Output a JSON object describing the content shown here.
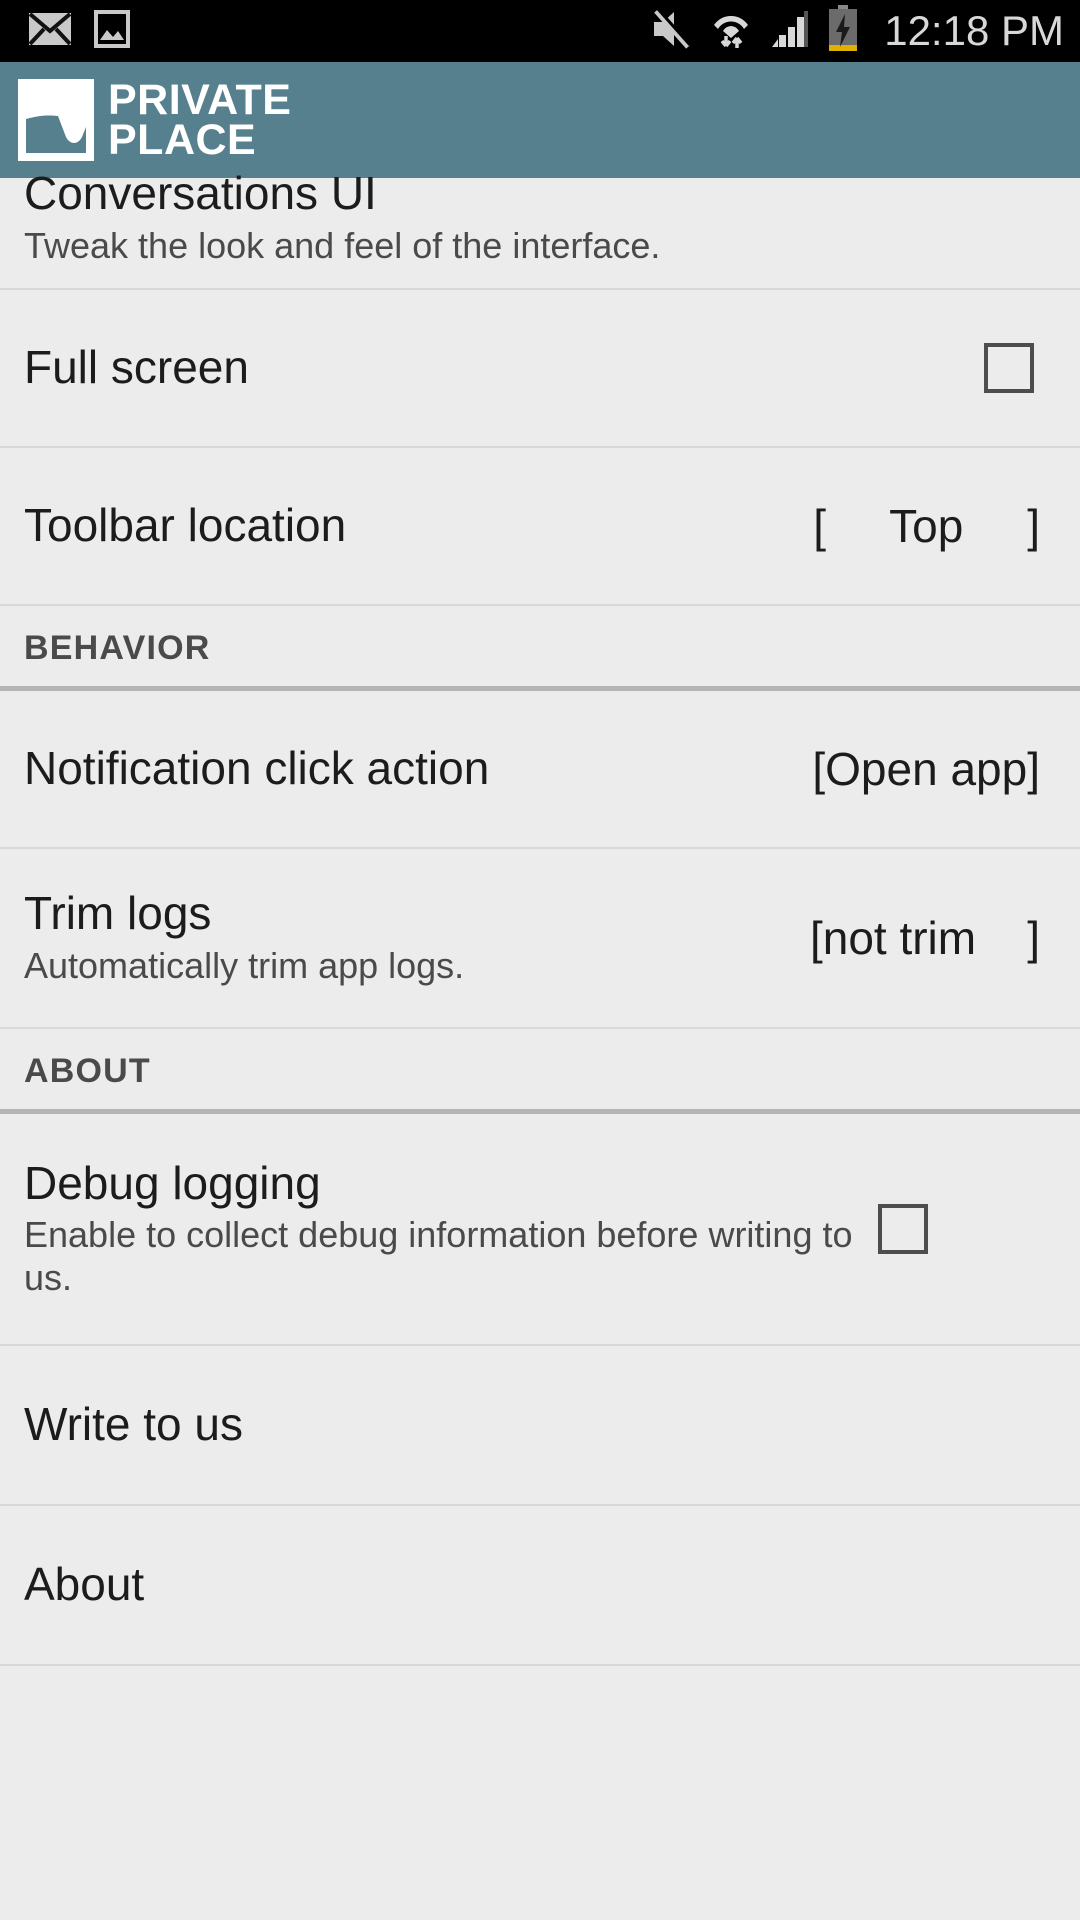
{
  "status_bar": {
    "icons_left": [
      "mail-icon",
      "image-icon"
    ],
    "icons_right": [
      "mute-icon",
      "wifi-icon",
      "signal-icon",
      "battery-charging-icon"
    ],
    "time": "12:18 PM"
  },
  "app_bar": {
    "logo_name": "private-place-logo",
    "title_line1": "PRIVATE",
    "title_line2": "PLACE",
    "background_color": "#57808f"
  },
  "settings": {
    "rows": [
      {
        "name": "conversations-ui",
        "title": "Conversations UI",
        "subtitle": "Tweak the look and feel of the interface.",
        "control": "none",
        "clipped": true
      },
      {
        "name": "full-screen",
        "title": "Full screen",
        "subtitle": "",
        "control": "checkbox",
        "checked": false
      },
      {
        "name": "toolbar-location",
        "title": "Toolbar location",
        "subtitle": "",
        "control": "value",
        "value": "[     Top     ]"
      }
    ],
    "behavior_section": {
      "name": "behavior",
      "label": "BEHAVIOR",
      "rows": [
        {
          "name": "notification-click-action",
          "title": "Notification click action",
          "subtitle": "",
          "control": "value",
          "value": "[Open app]"
        },
        {
          "name": "trim-logs",
          "title": "Trim logs",
          "subtitle": "Automatically trim app logs.",
          "control": "value",
          "value": "[not trim    ]"
        }
      ]
    },
    "about_section": {
      "name": "about",
      "label": "ABOUT",
      "rows": [
        {
          "name": "debug-logging",
          "title": "Debug logging",
          "subtitle": "Enable to collect debug information before writing to us.",
          "control": "checkbox",
          "checked": false
        },
        {
          "name": "write-to-us",
          "title": "Write to us",
          "subtitle": "",
          "control": "none"
        },
        {
          "name": "about",
          "title": "About",
          "subtitle": "",
          "control": "none"
        }
      ]
    }
  },
  "colors": {
    "page_background": "#ececec",
    "header_teal": "#57808f",
    "status_bar": "#000000",
    "primary_text": "#1c1c1c",
    "secondary_text": "#4a4a4a",
    "divider": "#d8d8d8",
    "divider_strong": "#b4b4b4"
  }
}
